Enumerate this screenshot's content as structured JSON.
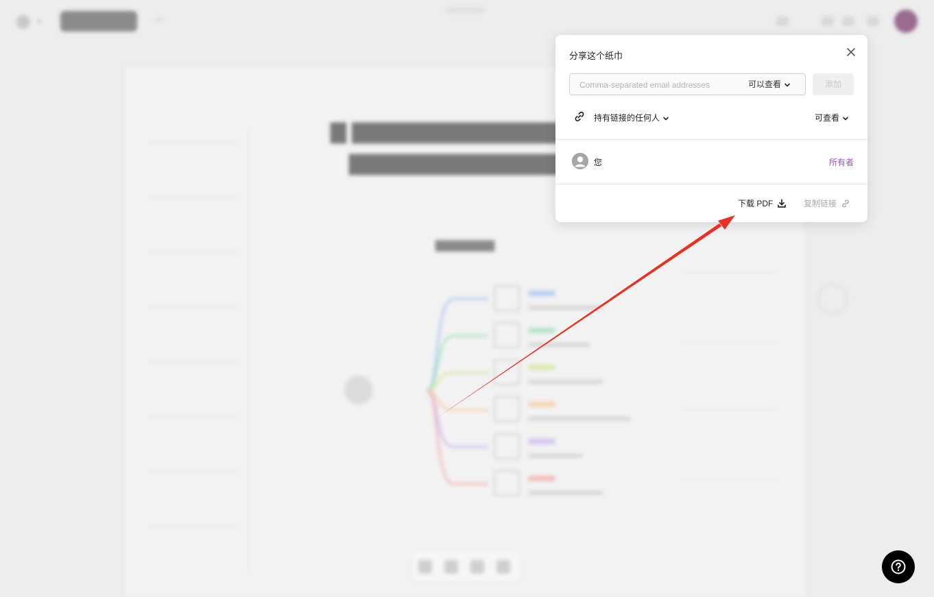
{
  "share_dialog": {
    "title": "分享这个纸巾",
    "email_placeholder": "Comma-separated email addresses",
    "email_permission": "可以查看",
    "add_button": "添加",
    "link_access": "持有链接的任何人",
    "link_permission": "可查看",
    "user": {
      "name": "您",
      "role": "所有者"
    },
    "download_pdf": "下载 PDF",
    "copy_link": "复制链接"
  },
  "colors": {
    "owner_role": "#a04ac8",
    "annotation_arrow": "#e53225",
    "help_button": "#000000"
  },
  "icons": [
    "close-icon",
    "chevron-down-icon",
    "link-icon",
    "user-avatar-icon",
    "download-icon",
    "copy-link-icon",
    "help-icon"
  ]
}
